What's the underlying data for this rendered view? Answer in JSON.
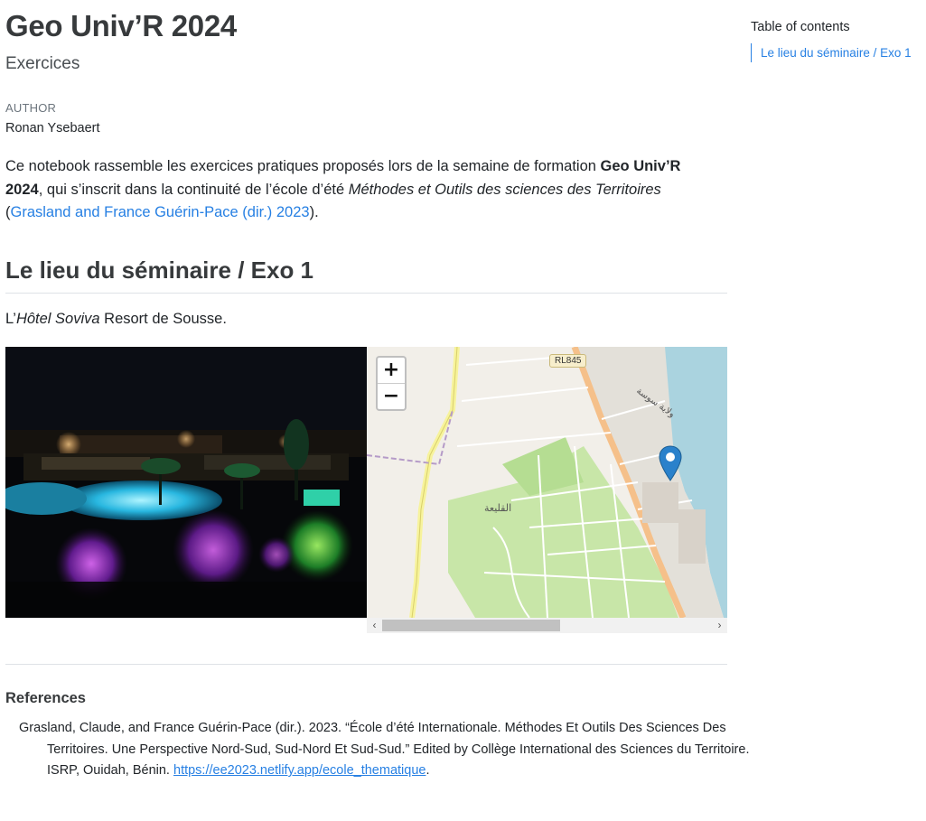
{
  "header": {
    "title": "Geo Univ’R 2024",
    "subtitle": "Exercices",
    "author_label": "AUTHOR",
    "author": "Ronan Ysebaert"
  },
  "intro": {
    "part1": "Ce notebook rassemble les exercices pratiques proposés lors de la semaine de formation ",
    "bold": "Geo Univ’R 2024",
    "part2": ", qui s’inscrit dans la continuité de l’école d’été ",
    "italic": "Méthodes et Outils des sciences des Territoires",
    "open_paren": " (",
    "citation": "Grasland and France Guérin-Pace (dir.) 2023",
    "close": ")."
  },
  "section": {
    "heading": "Le lieu du séminaire / Exo 1",
    "text_prefix": "L’",
    "text_italic": "Hôtel Soviva",
    "text_suffix": " Resort de Sousse."
  },
  "map": {
    "zoom_in": "+",
    "zoom_out": "−",
    "road_label": "RL845",
    "place_label": "القليعة",
    "coast_label": "ولاية سوسة",
    "marker_icon": "map-marker-icon",
    "marker_color": "#2a81cb",
    "scroll_left": "‹",
    "scroll_right": "›"
  },
  "references": {
    "title": "References",
    "entry": "Grasland, Claude, and France Guérin-Pace (dir.). 2023. “École d’été Internationale. Méthodes Et Outils Des Sciences Des Territoires. Une Perspective Nord-Sud, Sud-Nord Et Sud-Sud.” Edited by Collège International des Sciences du Territoire. ISRP, Ouidah, Bénin. ",
    "url": "https://ee2023.netlify.app/ecole_thematique",
    "end": "."
  },
  "toc": {
    "title": "Table of contents",
    "items": [
      {
        "label": "Le lieu du séminaire / Exo 1"
      }
    ]
  },
  "colors": {
    "link": "#2780e3",
    "heading": "#373a3c",
    "map_land": "#f2efe9",
    "map_sea": "#aad3df",
    "map_park": "#c8e6a8"
  }
}
